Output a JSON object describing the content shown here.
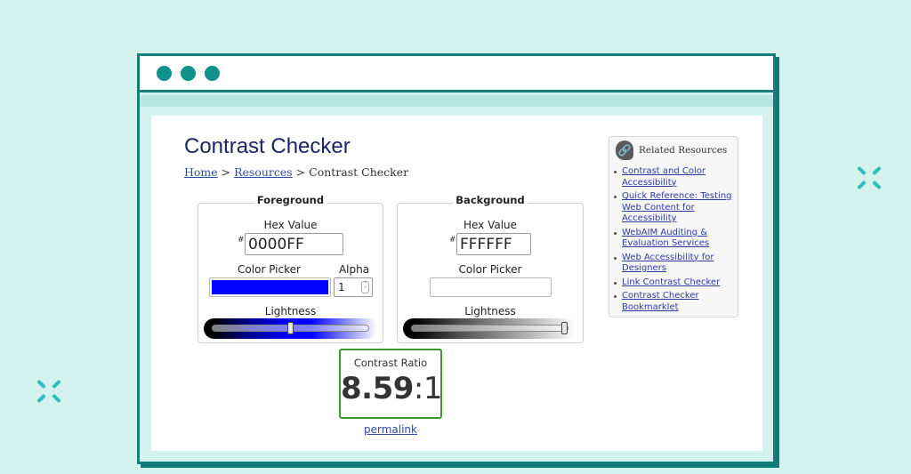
{
  "window": {
    "controls": [
      "close",
      "minimize",
      "maximize"
    ]
  },
  "page": {
    "title": "Contrast Checker",
    "breadcrumb": {
      "home": "Home",
      "sep1": " > ",
      "resources": "Resources",
      "sep2": " > ",
      "current": "Contrast Checker"
    }
  },
  "foreground": {
    "legend": "Foreground",
    "hex_label": "Hex Value",
    "hash": "#",
    "hex_value": "0000FF",
    "picker_label": "Color Picker",
    "picker_color": "#0000FF",
    "alpha_label": "Alpha",
    "alpha_value": "1",
    "lightness_label": "Lightness",
    "lightness_percent": 50
  },
  "background": {
    "legend": "Background",
    "hex_label": "Hex Value",
    "hash": "#",
    "hex_value": "FFFFFF",
    "picker_label": "Color Picker",
    "picker_color": "#FFFFFF",
    "lightness_label": "Lightness",
    "lightness_percent": 100
  },
  "result": {
    "label": "Contrast Ratio",
    "ratio": "8.59",
    "separator": ":",
    "denominator": "1",
    "permalink": "permalink",
    "pass_color": "#3a9a2c"
  },
  "related": {
    "icon": "link-icon",
    "title": "Related Resources",
    "links": [
      "Contrast and Color Accessibility",
      "Quick Reference: Testing Web Content for Accessibility",
      "WebAIM Auditing & Evaluation Services",
      "Web Accessibility for Designers",
      "Link Contrast Checker",
      "Contrast Checker Bookmarklet"
    ]
  },
  "colors": {
    "brand_teal": "#157d7a",
    "background_mint": "#d5f3ee",
    "title_navy": "#1e2463",
    "link_blue": "#2f4ba8"
  }
}
